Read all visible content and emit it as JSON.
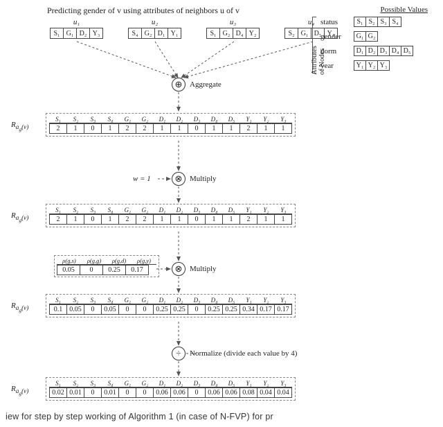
{
  "title": "Predicting gender of v using attributes of neighbors u of v",
  "possible_header": "Possible Values",
  "attributes_label": "Attributes of Nodes",
  "attributes": [
    {
      "name": "status",
      "values": [
        "S₁",
        "S₂",
        "S₃",
        "S₄"
      ]
    },
    {
      "name": "gender",
      "values": [
        "G₁",
        "G₂"
      ]
    },
    {
      "name": "dorm",
      "values": [
        "D₁",
        "D₂",
        "D₃",
        "D₄",
        "D₅"
      ]
    },
    {
      "name": "year",
      "values": [
        "Y₁",
        "Y₂",
        "Y₃"
      ]
    }
  ],
  "neighbors": [
    {
      "label": "u₁",
      "cells": [
        "S₁",
        "G₁",
        "D₂",
        "Y₃"
      ]
    },
    {
      "label": "u₂",
      "cells": [
        "S₄",
        "G₂",
        "D₁",
        "Y₁"
      ]
    },
    {
      "label": "u₃",
      "cells": [
        "S₁",
        "G₂",
        "D₄",
        "Y₂"
      ]
    },
    {
      "label": "u₄",
      "cells": [
        "S₂",
        "G₁",
        "D₅",
        "Y₁"
      ]
    }
  ],
  "ops": {
    "aggregate": {
      "symbol": "⊕",
      "label": "Aggregate"
    },
    "multiply1": {
      "symbol": "⊗",
      "label": "Multiply",
      "lhs": "w = 1"
    },
    "multiply2": {
      "symbol": "⊗",
      "label": "Multiply"
    },
    "normalize": {
      "symbol": "÷",
      "label": "Normalize (divide each value by 4)"
    }
  },
  "row_headers": [
    "S₁",
    "S₂",
    "S₃",
    "S₄",
    "G₁",
    "G₂",
    "D₁",
    "D₂",
    "D₃",
    "D₄",
    "D₅",
    "Y₁",
    "Y₂",
    "Y₃"
  ],
  "rows": {
    "r1": {
      "label": "R_{a_g(v)}",
      "values": [
        "2",
        "1",
        "0",
        "1",
        "2",
        "2",
        "1",
        "1",
        "0",
        "1",
        "1",
        "2",
        "1",
        "1"
      ]
    },
    "r2": {
      "label": "R_{a_g(v)}",
      "values": [
        "2",
        "1",
        "0",
        "1",
        "2",
        "2",
        "1",
        "1",
        "0",
        "1",
        "1",
        "2",
        "1",
        "1"
      ]
    },
    "r3": {
      "label": "R_{a_g(v)}",
      "values": [
        "0.1",
        "0.05",
        "0",
        "0.05",
        "0",
        "0",
        "0.25",
        "0.25",
        "0",
        "0.25",
        "0.25",
        "0.34",
        "0.17",
        "0.17"
      ]
    },
    "r4": {
      "label": "R_{a_g(v)}",
      "values": [
        "0.02",
        "0.01",
        "0",
        "0.01",
        "0",
        "0",
        "0.06",
        "0.06",
        "0",
        "0.06",
        "0.06",
        "0.08",
        "0.04",
        "0.04"
      ]
    }
  },
  "rho": {
    "headers": [
      "ρ(g,s)",
      "ρ(g,g)",
      "ρ(g,d)",
      "ρ(g,y)"
    ],
    "values": [
      "0.05",
      "0",
      "0.25",
      "0.17"
    ]
  },
  "bottom_caption": "iew for step by step working of Algorithm 1 (in case of N-FVP) for pr"
}
